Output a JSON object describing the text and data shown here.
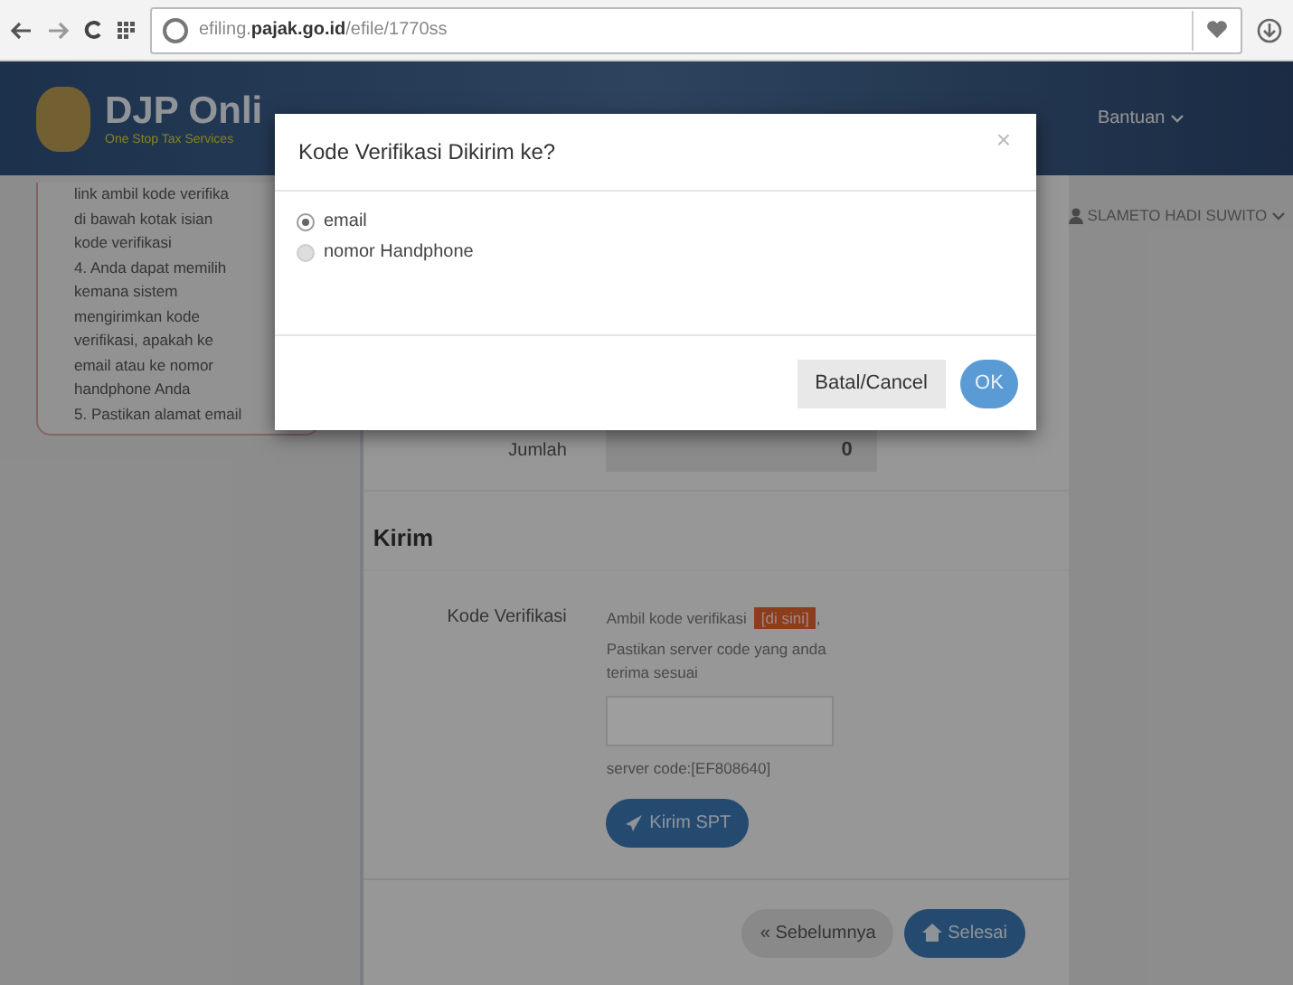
{
  "browser": {
    "url_host_prefix": "efiling.",
    "url_host": "pajak.go.id",
    "url_path": "/efile/1770ss"
  },
  "header": {
    "logo_title": "DJP Onli",
    "logo_subtitle": "One Stop Tax Services",
    "help_menu": "Bantuan",
    "user_menu": "SLAMETO HADI SUWITO"
  },
  "help_panel": {
    "lines": [
      "link ambil kode verifika",
      "di bawah kotak isian",
      "kode verifikasi",
      "4. Anda dapat memilih",
      "kemana sistem",
      "mengirimkan kode",
      "verifikasi, apakah ke",
      "email atau ke nomor",
      "handphone Anda",
      "5. Pastikan alamat email"
    ]
  },
  "form": {
    "total_label": "Jumlah",
    "total_value": "0",
    "section_title": "Kirim",
    "code_label": "Kode Verifikasi",
    "code_hint": "Ambil kode verifikasi",
    "code_link": "[di sini]",
    "code_hint_end": ",",
    "code_note": "Pastikan server code yang anda terima sesuai",
    "server_code": "server code:[EF808640]",
    "send_button": "Kirim SPT",
    "prev_button": "« Sebelumnya",
    "finish_button": "Selesai"
  },
  "dialog": {
    "title": "Kode Verifikasi Dikirim ke?",
    "close": "×",
    "options": [
      {
        "label": "email",
        "selected": true
      },
      {
        "label": "nomor Handphone",
        "selected": false
      }
    ],
    "cancel_button": "Batal/Cancel",
    "ok_button": "OK"
  }
}
